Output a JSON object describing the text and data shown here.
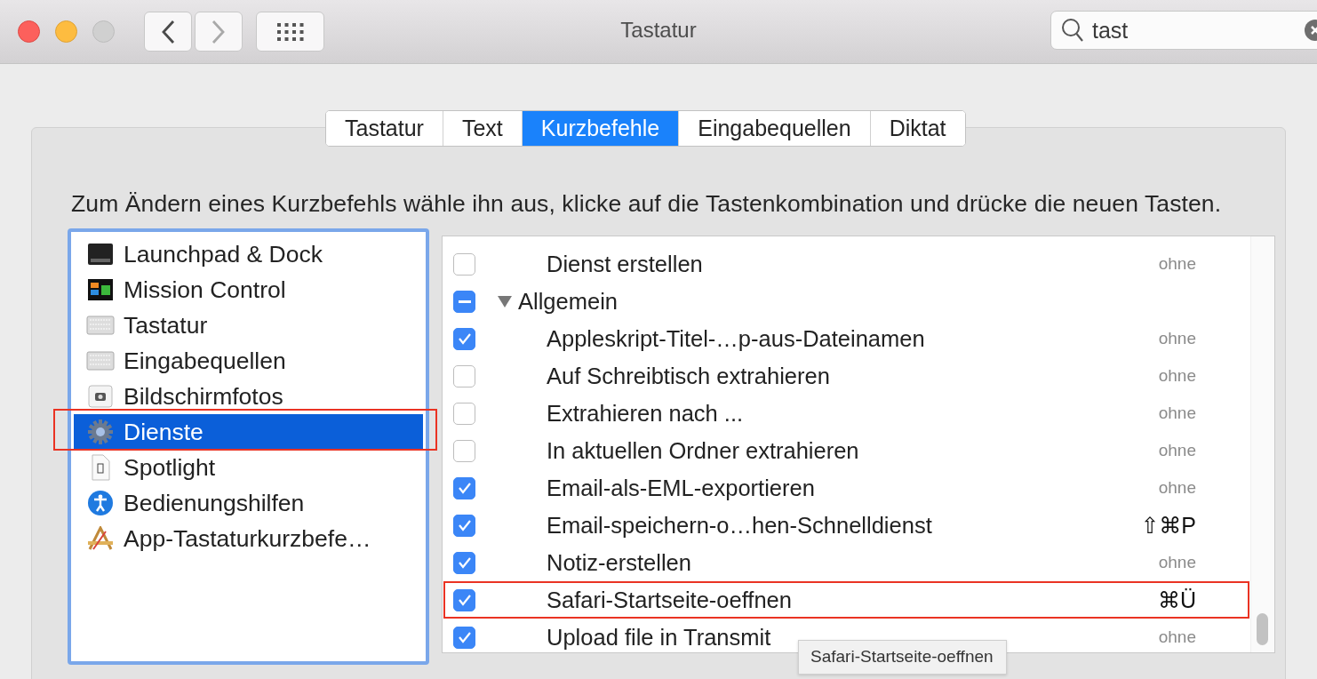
{
  "window": {
    "title": "Tastatur",
    "back_enabled": true,
    "forward_enabled": false
  },
  "search": {
    "value": "tast"
  },
  "tabs": [
    {
      "label": "Tastatur",
      "selected": false
    },
    {
      "label": "Text",
      "selected": false
    },
    {
      "label": "Kurzbefehle",
      "selected": true
    },
    {
      "label": "Eingabequellen",
      "selected": false
    },
    {
      "label": "Diktat",
      "selected": false
    }
  ],
  "description": "Zum Ändern eines Kurzbefehls wähle ihn aus, klicke auf die Tastenkombination und drücke die neuen Tasten.",
  "sidebar": {
    "items": [
      {
        "label": "Launchpad & Dock",
        "selected": false,
        "highlighted": false
      },
      {
        "label": "Mission Control",
        "selected": false,
        "highlighted": false
      },
      {
        "label": "Tastatur",
        "selected": false,
        "highlighted": false
      },
      {
        "label": "Eingabequellen",
        "selected": false,
        "highlighted": false
      },
      {
        "label": "Bildschirmfotos",
        "selected": false,
        "highlighted": false
      },
      {
        "label": "Dienste",
        "selected": true,
        "highlighted": true
      },
      {
        "label": "Spotlight",
        "selected": false,
        "highlighted": false
      },
      {
        "label": "Bedienungshilfen",
        "selected": false,
        "highlighted": false
      },
      {
        "label": "App-Tastaturkurzbefe…",
        "selected": false,
        "highlighted": false
      }
    ]
  },
  "shortcuts": [
    {
      "kind": "item",
      "label": "Dienst erstellen",
      "checked": false,
      "shortcut": "ohne",
      "assigned": false,
      "highlighted": false
    },
    {
      "kind": "group",
      "label": "Allgemein",
      "mixed": true,
      "expanded": true,
      "children": [
        {
          "label": "Appleskript-Titel-…p-aus-Dateinamen",
          "checked": true,
          "shortcut": "ohne",
          "assigned": false,
          "highlighted": false
        },
        {
          "label": "Auf Schreibtisch extrahieren",
          "checked": false,
          "shortcut": "ohne",
          "assigned": false,
          "highlighted": false
        },
        {
          "label": "Extrahieren nach ...",
          "checked": false,
          "shortcut": "ohne",
          "assigned": false,
          "highlighted": false
        },
        {
          "label": "In aktuellen Ordner extrahieren",
          "checked": false,
          "shortcut": "ohne",
          "assigned": false,
          "highlighted": false
        },
        {
          "label": "Email-als-EML-exportieren",
          "checked": true,
          "shortcut": "ohne",
          "assigned": false,
          "highlighted": false
        },
        {
          "label": "Email-speichern-o…hen-Schnelldienst",
          "checked": true,
          "shortcut": "⇧⌘P",
          "assigned": true,
          "highlighted": false
        },
        {
          "label": "Notiz-erstellen",
          "checked": true,
          "shortcut": "ohne",
          "assigned": false,
          "highlighted": false
        },
        {
          "label": "Safari-Startseite-oeffnen",
          "checked": true,
          "shortcut": "⌘Ü",
          "assigned": true,
          "highlighted": true
        },
        {
          "label": "Upload file in Transmit",
          "checked": true,
          "shortcut": "ohne",
          "assigned": false,
          "highlighted": false
        }
      ]
    }
  ],
  "tooltip": {
    "text": "Safari-Startseite-oeffnen"
  }
}
